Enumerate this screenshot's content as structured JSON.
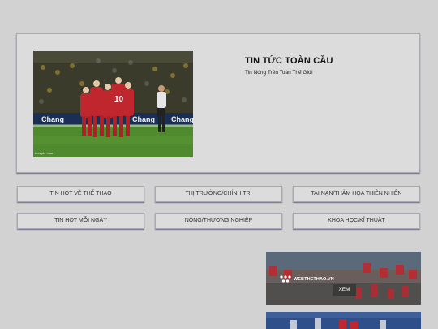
{
  "hero": {
    "title": "TIN TỨC TOÀN CẦU",
    "subtitle": "Tin Nóng Trên Toàn Thế Giới",
    "photo_ad_text": "Chang",
    "photo_credit": "bongda.com"
  },
  "categories": [
    {
      "label": "TIN HOT VỀ THỂ THAO"
    },
    {
      "label": "THỊ TRƯỜNG/CHÍNH TRỊ"
    },
    {
      "label": "TAI NẠN/THẢM HỌA THIÊN NHIÊN"
    },
    {
      "label": "TIN HOT MỖI NGÀY"
    },
    {
      "label": "NÔNG/THƯƠNG NGHIỆP"
    },
    {
      "label": "KHOA HỌC/KĨ THUẬT"
    }
  ],
  "thumbnails": [
    {
      "logo_text": "WEBTHETHAO.VN",
      "button_label": "XEM"
    }
  ],
  "colors": {
    "background": "#d2d2d2",
    "card": "#dddcdd",
    "card_shadow": "#6e6a8e",
    "jersey_red": "#c0262d",
    "pitch_green": "#4f8a2e"
  }
}
